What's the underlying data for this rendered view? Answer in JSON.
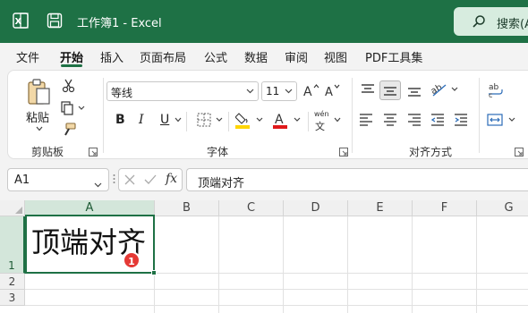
{
  "titlebar": {
    "title": "工作簿1  -  Excel",
    "search_label": "搜索(A"
  },
  "menu": {
    "items": [
      "文件",
      "开始",
      "插入",
      "页面布局",
      "公式",
      "数据",
      "审阅",
      "视图",
      "PDF工具集"
    ],
    "active_index": 1
  },
  "ribbon": {
    "clipboard": {
      "paste_label": "粘贴",
      "group_label": "剪贴板"
    },
    "font": {
      "font_name": "等线",
      "font_size": "11",
      "bold": "B",
      "italic": "I",
      "underline": "U",
      "font_color_letter": "A",
      "phonetic_top": "wén",
      "phonetic_bottom": "文",
      "group_label": "字体",
      "highlight_color": "#ffd500",
      "font_color": "#e0191b"
    },
    "alignment": {
      "group_label": "对齐方式"
    }
  },
  "formula_bar": {
    "name_box": "A1",
    "fx_label": "fx",
    "content": "顶端对齐"
  },
  "sheet": {
    "columns": [
      "A",
      "B",
      "C",
      "D",
      "E",
      "F",
      "G"
    ],
    "rows": [
      "1",
      "2",
      "3"
    ],
    "active_cell_text": "顶端对齐",
    "badge": "1"
  },
  "colors": {
    "accent": "#1e7145",
    "badge": "#e53935"
  }
}
